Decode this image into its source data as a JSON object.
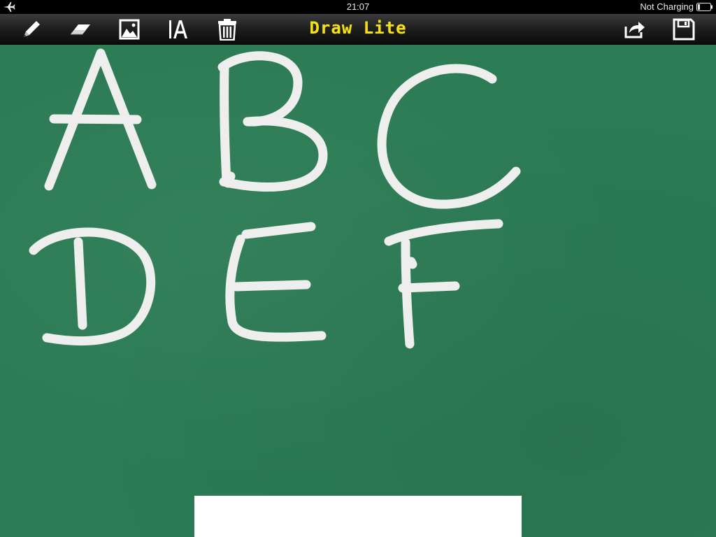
{
  "status_bar": {
    "time": "21:07",
    "charging_status": "Not Charging",
    "icons": [
      "airplane-icon",
      "battery-icon"
    ]
  },
  "toolbar": {
    "title": "Draw Lite",
    "title_color": "#f2e01c",
    "tools": [
      "pencil-icon",
      "eraser-icon",
      "image-icon",
      "text-icon",
      "trash-icon"
    ],
    "actions": [
      "share-icon",
      "save-icon"
    ]
  },
  "canvas": {
    "background_color": "#2b7b54",
    "stroke_color": "#eeeeee",
    "drawn_letters": [
      "A",
      "B",
      "C",
      "D",
      "E",
      "F"
    ]
  },
  "ad_banner": {
    "background_color": "#ffffff"
  }
}
